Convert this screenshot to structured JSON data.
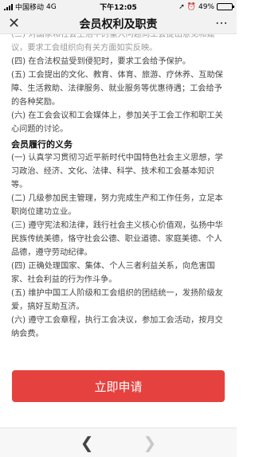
{
  "status_bar": {
    "carrier": "中国移动",
    "network": "4G",
    "time": "下午12:05",
    "battery": "49%",
    "battery_level": 0.49
  },
  "nav": {
    "title": "会员权利及职责",
    "close_icon": "close-icon",
    "more_icon": "more-icon"
  },
  "content": {
    "rights_paragraphs": [
      "(三) 对国家和社会生活中的重大问题向工会提出意见和建议，要求工会组织向有关方面如实反映。",
      "(四) 在合法权益受到侵犯时，要求工会给予保护。",
      "(五) 工会提出的文化、教育、体育、旅游、疗休养、互助保障、生活救助、法律服务、就业服务等优惠待遇；工会给予的各种奖励。",
      "(六) 在工会会议和工会媒体上，参加关于工会工作和职工关心问题的讨论。"
    ],
    "duties_title": "会员履行的义务",
    "duties_paragraphs": [
      "(一) 认真学习贯彻习近平新时代中国特色社会主义思想，学习政治、经济、文化、法律、科学、技术和工会基本知识等。",
      "(二) 几级参加民主管理，努力完成生产和工作任务，立足本职岗位建功立业。",
      "(三) 遵守宪法和法律，践行社会主义核心价值观，弘扬中华民族传统美德，恪守社会公德、职业道德、家庭美德、个人品德，遵守劳动纪律。",
      "(四) 正确处理国家、集体、个人三者利益关系，向危害国家、社会利益的行为作斗争。",
      "(五) 维护中国工人阶级和工会组织的团结统一，发扬阶级友爱，搞好互助互济。",
      "(六) 遵守工会章程，执行工会决议，参加工会活动，按月交纳会费。"
    ]
  },
  "apply_button_label": "立即申请",
  "bottom_nav": {
    "back_icon": "back-arrow-icon",
    "forward_icon": "forward-arrow-icon"
  },
  "colors": {
    "accent": "#e5423f",
    "bar_bg": "#f2f2f2",
    "text": "#444444"
  }
}
